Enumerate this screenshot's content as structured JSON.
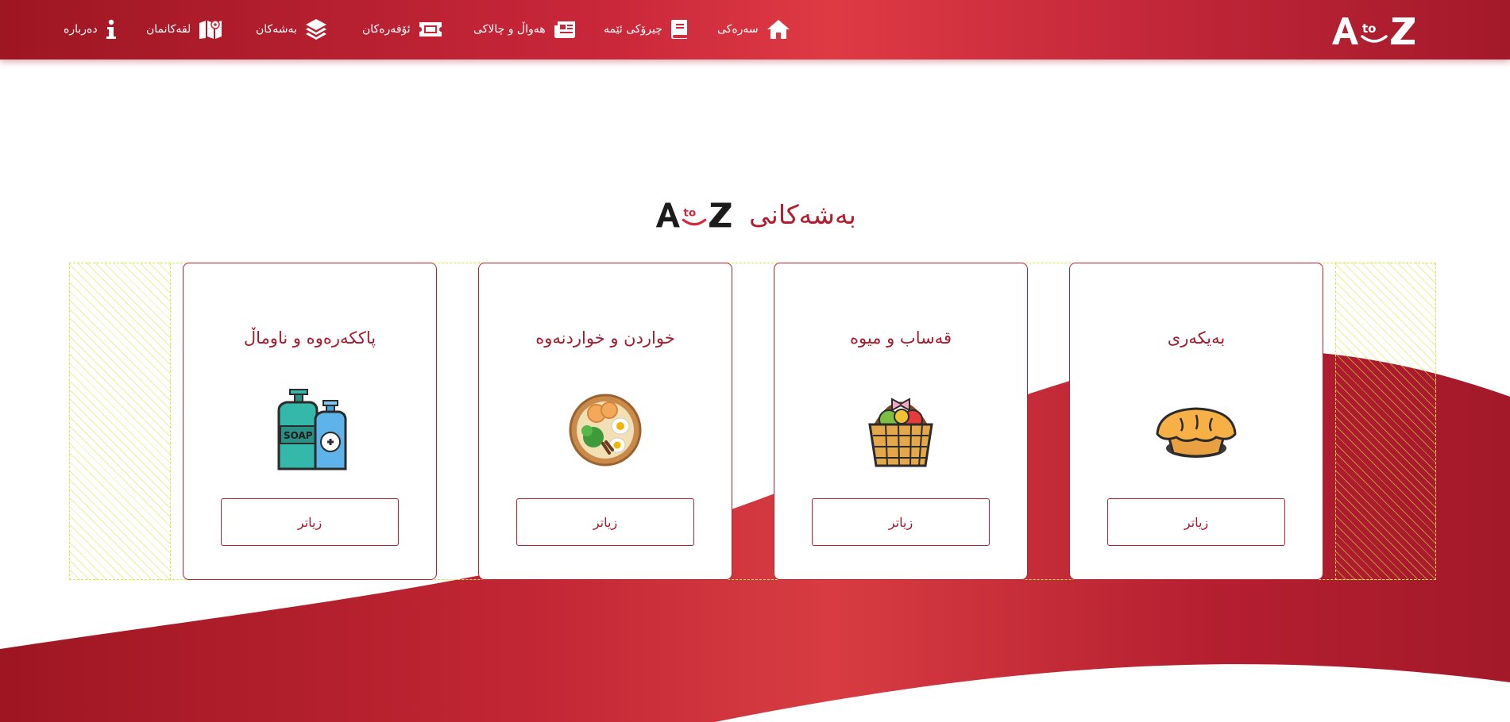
{
  "colors": {
    "brand": "#c9273a",
    "brand_dark": "#9e1622",
    "text": "#a51b2c",
    "stripe": "#d9e84a"
  },
  "header": {
    "logo_alt": "AtoZ",
    "nav": [
      {
        "label": "سەرەکی",
        "icon": "home-icon"
      },
      {
        "label": "چیرۆکی ئێمە",
        "icon": "book-icon"
      },
      {
        "label": "هەواڵ و چالاکی",
        "icon": "newspaper-icon"
      },
      {
        "label": "ئۆفەرەکان",
        "icon": "ticket-icon"
      },
      {
        "label": "بەشەکان",
        "icon": "layers-icon"
      },
      {
        "label": "لقەکانمان",
        "icon": "map-icon"
      },
      {
        "label": "دەربارە",
        "icon": "info-icon"
      }
    ]
  },
  "section": {
    "title": "بەشەکانی"
  },
  "cards": [
    {
      "title": "بەیکەری",
      "icon": "pie-icon",
      "button": "زیاتر"
    },
    {
      "title": "قەساب و میوە",
      "icon": "fruit-basket-icon",
      "button": "زیاتر"
    },
    {
      "title": "خواردن و خواردنەوە",
      "icon": "food-bowl-icon",
      "button": "زیاتر"
    },
    {
      "title": "پاککەرەوە و ناوماڵ",
      "icon": "soap-bottles-icon",
      "button": "زیاتر"
    }
  ]
}
